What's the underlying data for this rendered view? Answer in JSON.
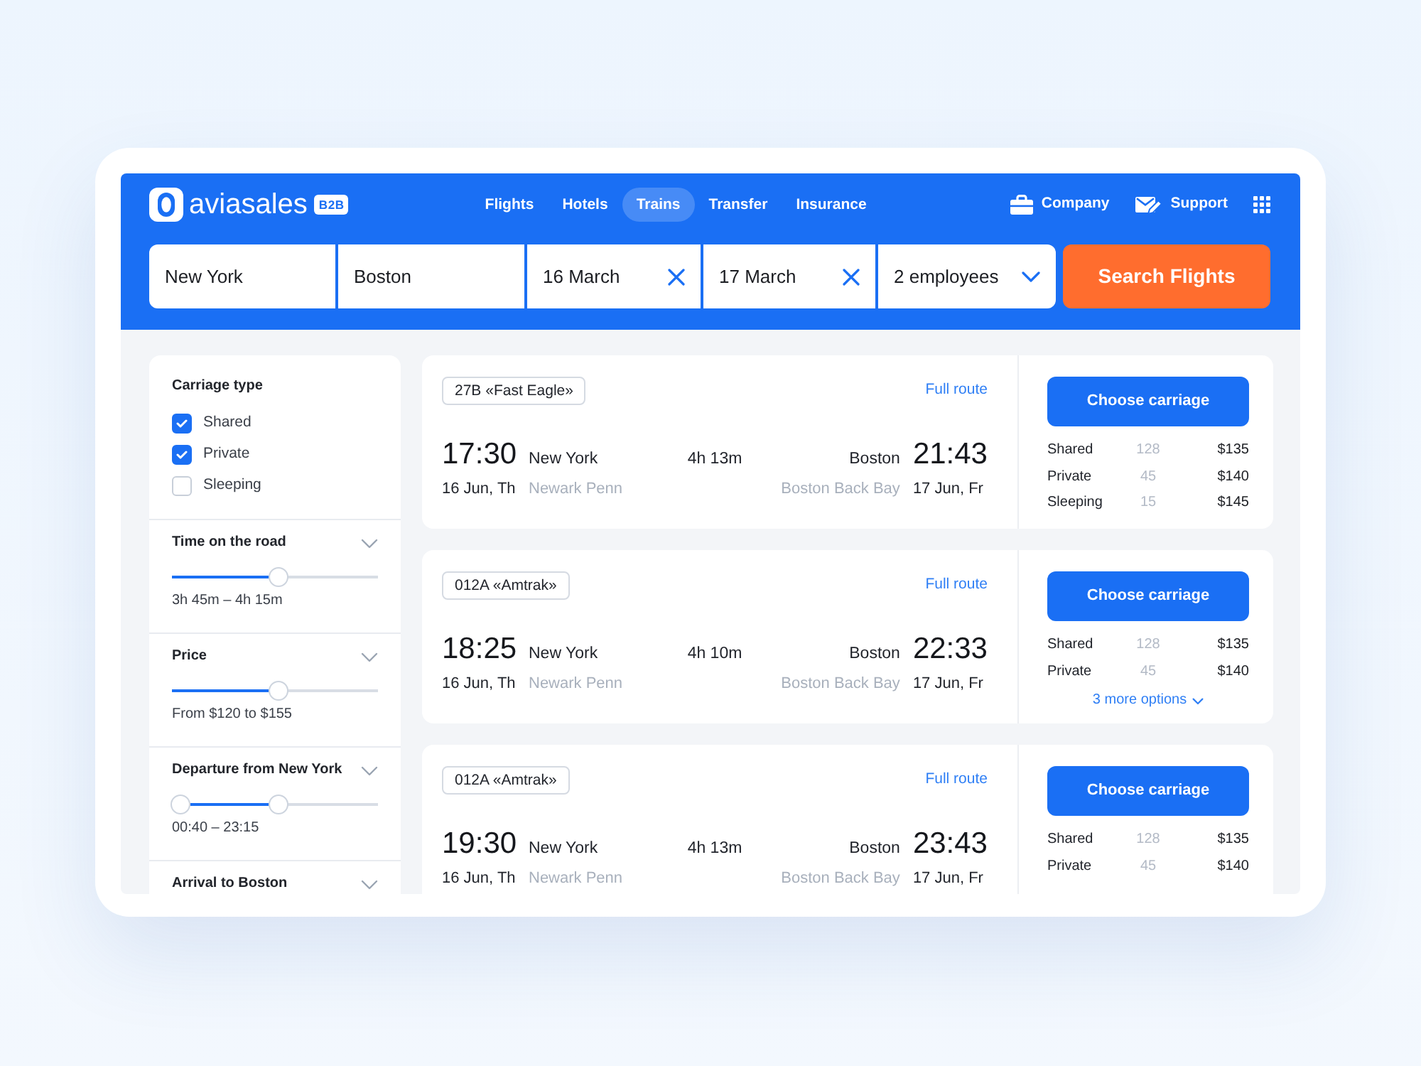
{
  "header": {
    "logo": {
      "text": "aviasales",
      "tag": "B2B"
    },
    "nav": [
      {
        "label": "Flights",
        "selected": false
      },
      {
        "label": "Hotels",
        "selected": false
      },
      {
        "label": "Trains",
        "selected": true
      },
      {
        "label": "Transfer",
        "selected": false
      },
      {
        "label": "Insurance",
        "selected": false
      }
    ],
    "links": [
      {
        "label": "Company"
      },
      {
        "label": "Support"
      }
    ]
  },
  "search": {
    "fields": [
      {
        "kind": "text",
        "value": "New York"
      },
      {
        "kind": "text",
        "value": "Boston"
      },
      {
        "kind": "date",
        "value": "16 March"
      },
      {
        "kind": "date",
        "value": "17 March"
      },
      {
        "kind": "select",
        "value": "2 employees"
      }
    ],
    "button": "Search Flights"
  },
  "filters": {
    "carriage": {
      "title": "Carriage type",
      "options": [
        {
          "label": "Shared",
          "checked": true
        },
        {
          "label": "Private",
          "checked": true
        },
        {
          "label": "Sleeping",
          "checked": false
        }
      ]
    },
    "sections": [
      {
        "title": "Time on the road",
        "thumbs": [
          {
            "level": 0.52
          }
        ],
        "reading": "3h 45m – 4h 15m"
      },
      {
        "title": "Price",
        "thumbs": [
          {
            "level": 0.52
          }
        ],
        "reading": "From $120 to $155"
      },
      {
        "title": "Departure from New York",
        "thumbs": [
          {
            "level": 0.04
          },
          {
            "level": 0.52
          }
        ],
        "reading": "00:40 – 23:15"
      },
      {
        "title": "Arrival to Boston"
      }
    ]
  },
  "results": [
    {
      "train": "27B «Fast Eagle»",
      "route_link": "Full route",
      "departure": {
        "time": "17:30",
        "city": "New York",
        "date": "16 Jun, Th",
        "station": "Newark Penn"
      },
      "duration": "4h 13m",
      "arrival": {
        "time": "21:43",
        "city": "Boston",
        "date": "17 Jun, Fr",
        "station": "Boston Back Bay"
      },
      "button": "Choose carriage",
      "fares": [
        {
          "class": "Shared",
          "seats": "128",
          "price": "$135"
        },
        {
          "class": "Private",
          "seats": "45",
          "price": "$140"
        },
        {
          "class": "Sleeping",
          "seats": "15",
          "price": "$145"
        }
      ]
    },
    {
      "train": "012A «Amtrak»",
      "route_link": "Full route",
      "departure": {
        "time": "18:25",
        "city": "New York",
        "date": "16 Jun, Th",
        "station": "Newark Penn"
      },
      "duration": "4h 10m",
      "arrival": {
        "time": "22:33",
        "city": "Boston",
        "date": "17 Jun, Fr",
        "station": "Boston Back Bay"
      },
      "button": "Choose carriage",
      "fares": [
        {
          "class": "Shared",
          "seats": "128",
          "price": "$135"
        },
        {
          "class": "Private",
          "seats": "45",
          "price": "$140"
        }
      ],
      "more_link": "3 more options"
    },
    {
      "train": "012A «Amtrak»",
      "route_link": "Full route",
      "departure": {
        "time": "19:30",
        "city": "New York",
        "date": "16 Jun, Th",
        "station": "Newark Penn"
      },
      "duration": "4h 13m",
      "arrival": {
        "time": "23:43",
        "city": "Boston",
        "date": "17 Jun, Fr",
        "station": "Boston Back Bay"
      },
      "button": "Choose carriage",
      "fares": [
        {
          "class": "Shared",
          "seats": "128",
          "price": "$135"
        },
        {
          "class": "Private",
          "seats": "45",
          "price": "$140"
        }
      ]
    }
  ]
}
